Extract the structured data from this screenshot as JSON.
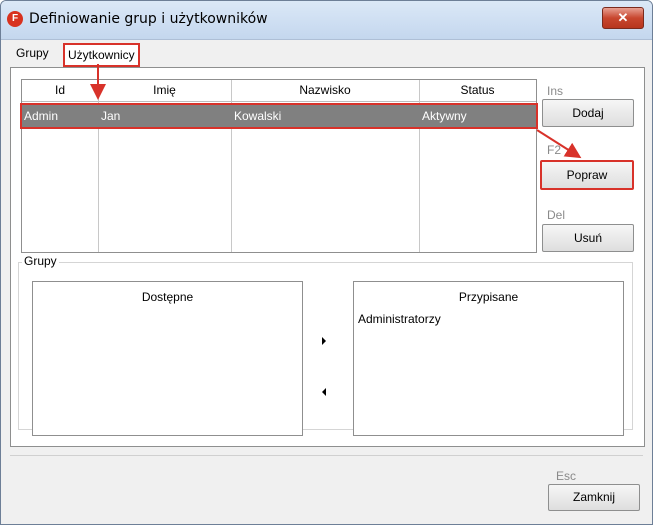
{
  "window": {
    "title": "Definiowanie grup i użytkowników",
    "close_glyph": "✕",
    "app_icon_letter": "F"
  },
  "tabs": [
    {
      "label": "Grupy",
      "active": false
    },
    {
      "label": "Użytkownicy",
      "active": true
    }
  ],
  "users_table": {
    "columns": [
      "Id",
      "Imię",
      "Nazwisko",
      "Status"
    ],
    "rows": [
      {
        "id": "Admin",
        "imie": "Jan",
        "nazwisko": "Kowalski",
        "status": "Aktywny",
        "selected": true
      }
    ]
  },
  "actions": {
    "add": {
      "shortcut": "Ins",
      "label": "Dodaj"
    },
    "edit": {
      "shortcut": "F2",
      "label": "Popraw"
    },
    "delete": {
      "shortcut": "Del",
      "label": "Usuń"
    }
  },
  "groups": {
    "legend": "Grupy",
    "available": {
      "header": "Dostępne",
      "items": []
    },
    "assigned": {
      "header": "Przypisane",
      "items": [
        "Administratorzy"
      ]
    }
  },
  "footer": {
    "close": {
      "shortcut": "Esc",
      "label": "Zamknij"
    }
  },
  "colors": {
    "highlight": "#d8322a",
    "selection": "#808080",
    "close_button": "#c8472f"
  }
}
